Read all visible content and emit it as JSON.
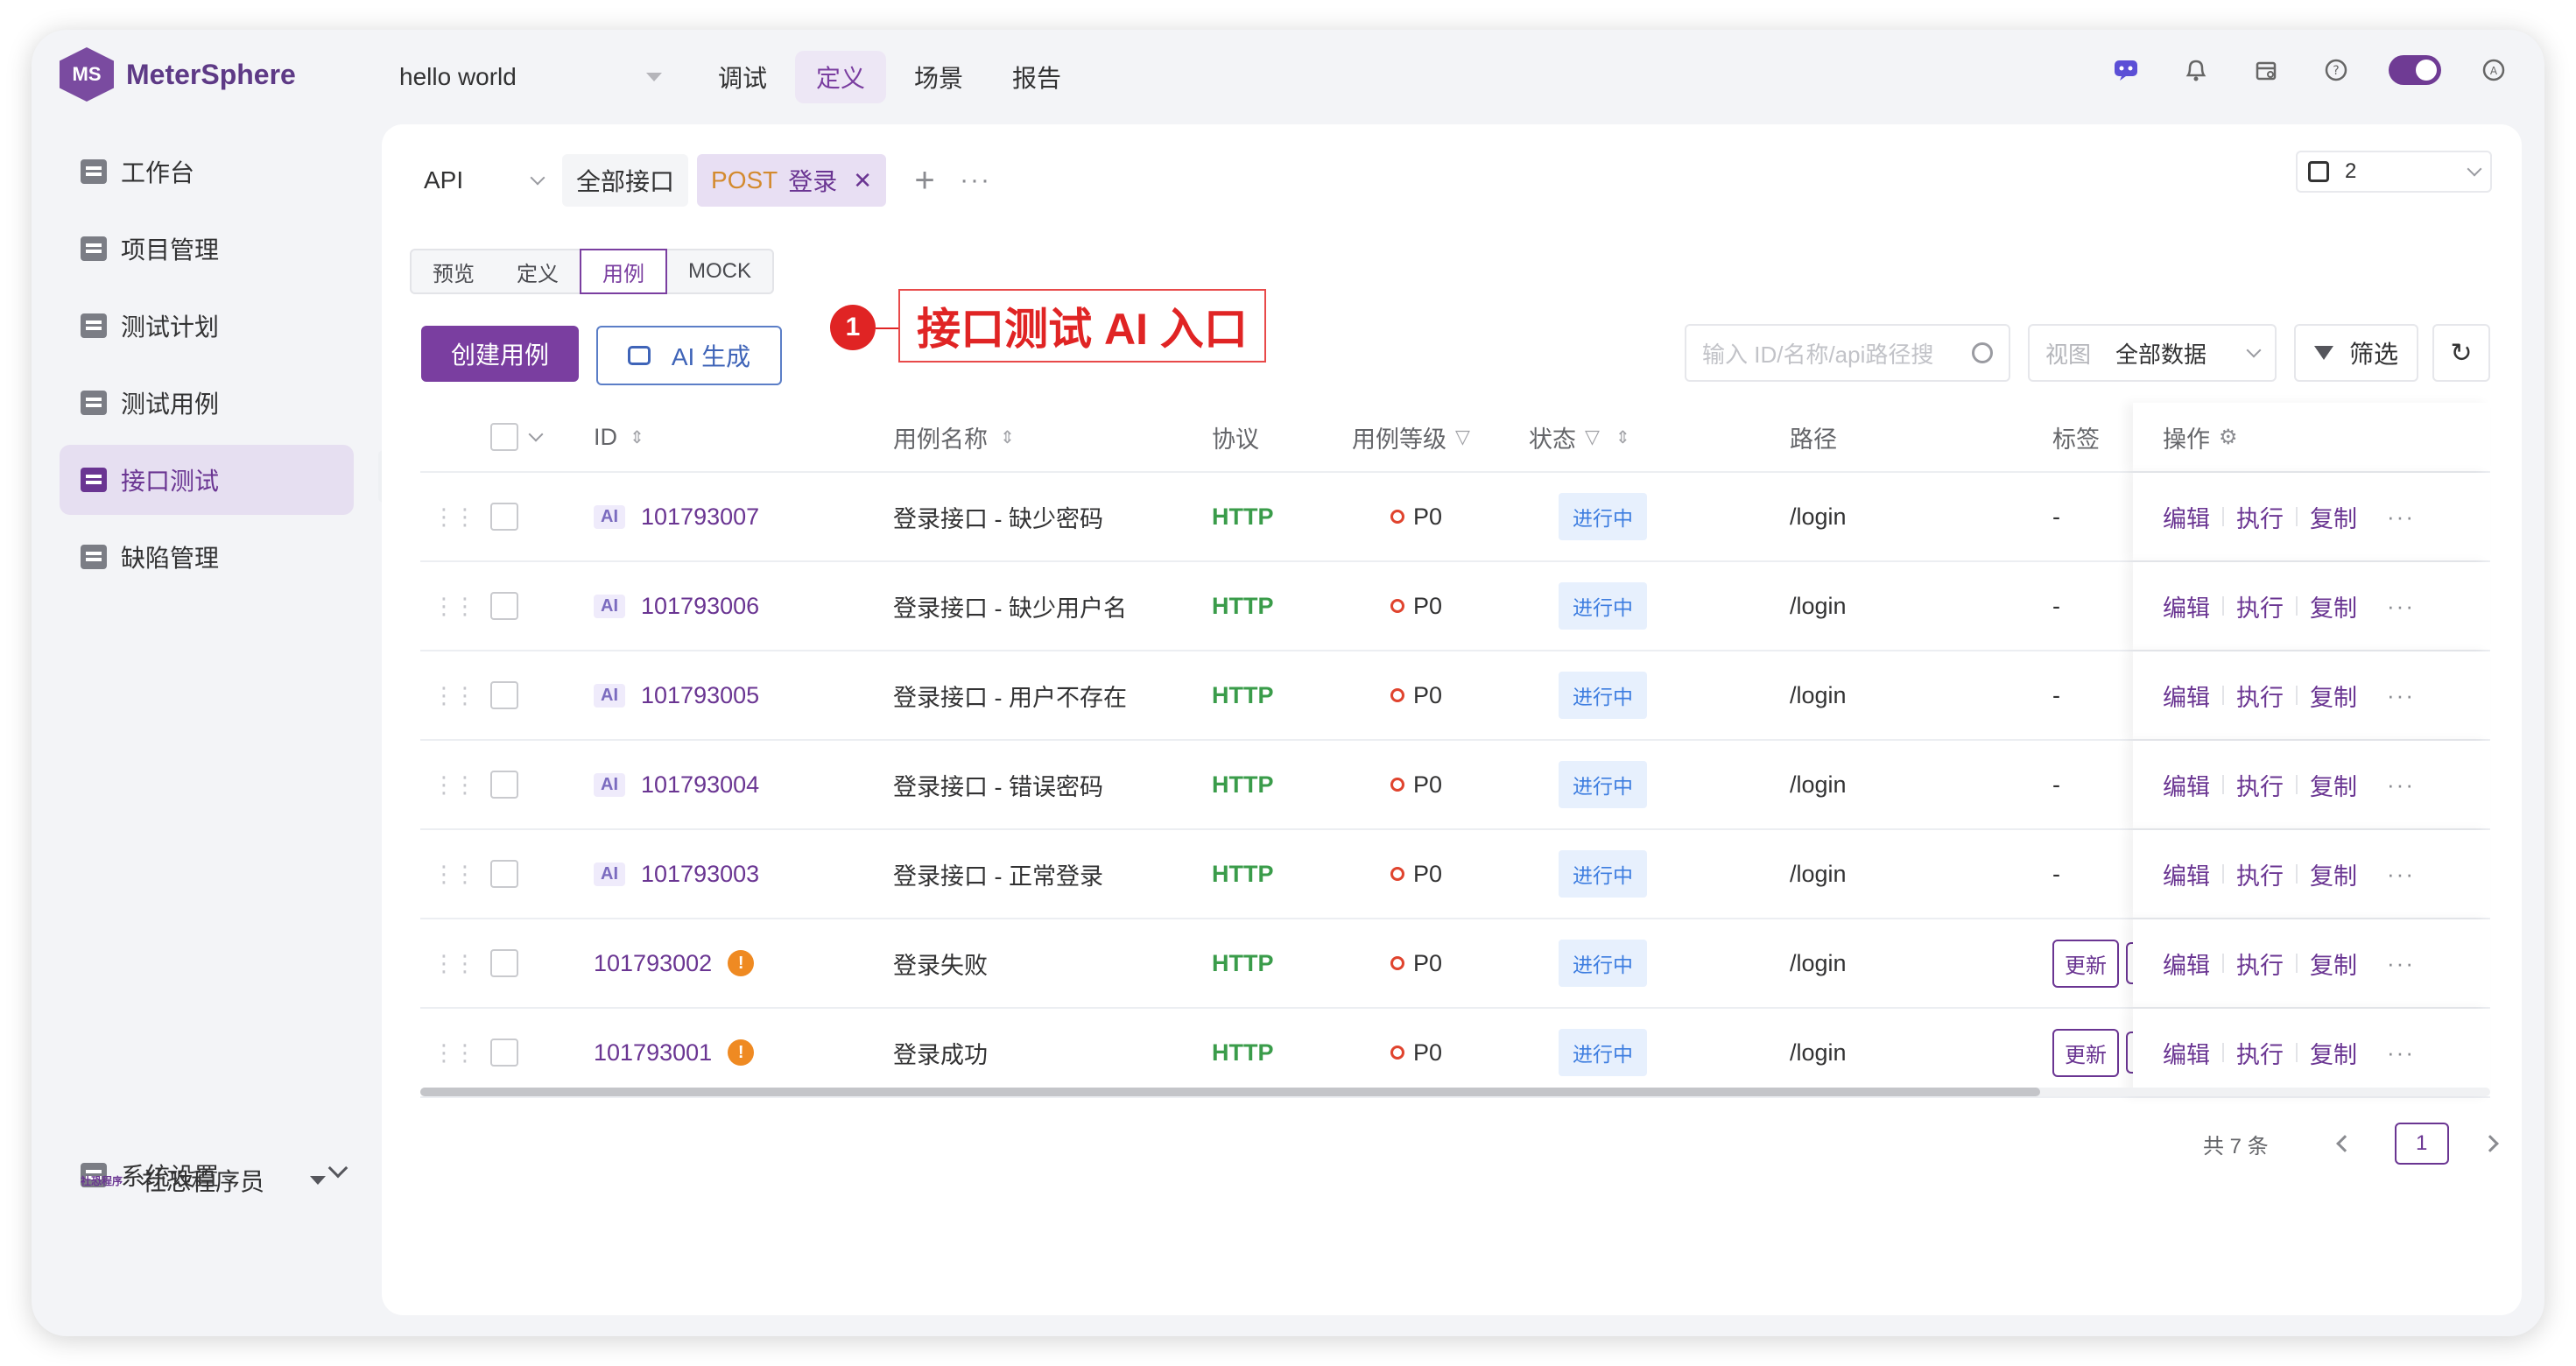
{
  "app": {
    "logo_text": "MeterSphere",
    "project_name": "hello world"
  },
  "top_nav": {
    "items": [
      "调试",
      "定义",
      "场景",
      "报告"
    ],
    "active": "定义"
  },
  "top_icons": [
    "ai-assistant-icon",
    "bell-icon",
    "calendar-icon",
    "help-icon",
    "theme-toggle",
    "avatar-icon"
  ],
  "sidebar": {
    "items": [
      {
        "label": "工作台",
        "icon": "workbench-icon"
      },
      {
        "label": "项目管理",
        "icon": "project-icon"
      },
      {
        "label": "测试计划",
        "icon": "plan-icon"
      },
      {
        "label": "测试用例",
        "icon": "case-icon"
      },
      {
        "label": "接口测试",
        "icon": "api-test-icon"
      },
      {
        "label": "缺陷管理",
        "icon": "bug-icon"
      }
    ],
    "active": "接口测试",
    "settings_label": "系统设置",
    "user_org": "社恐程序",
    "user_name": "社恐程序员"
  },
  "tabbar": {
    "protocol": "API",
    "tabs": [
      {
        "label": "全部接口"
      },
      {
        "method": "POST",
        "label": "登录",
        "closable": true
      }
    ],
    "environment": "2"
  },
  "subtabs": {
    "items": [
      "预览",
      "定义",
      "用例",
      "MOCK"
    ],
    "active": "用例"
  },
  "actions": {
    "create_label": "创建用例",
    "ai_label": "AI 生成"
  },
  "annotation": {
    "number": "1",
    "text": "接口测试 AI 入口"
  },
  "filters": {
    "search_placeholder": "输入 ID/名称/api路径搜",
    "view_label": "视图",
    "view_value": "全部数据",
    "filter_label": "筛选"
  },
  "table": {
    "headers": {
      "id": "ID",
      "name": "用例名称",
      "protocol": "协议",
      "level": "用例等级",
      "status": "状态",
      "path": "路径",
      "tags": "标签",
      "ops": "操作"
    },
    "rows": [
      {
        "ai": "AI",
        "id": "101793007",
        "name": "登录接口 - 缺少密码",
        "protocol": "HTTP",
        "level": "P0",
        "status": "进行中",
        "path": "/login",
        "tag": "-"
      },
      {
        "ai": "AI",
        "id": "101793006",
        "name": "登录接口 - 缺少用户名",
        "protocol": "HTTP",
        "level": "P0",
        "status": "进行中",
        "path": "/login",
        "tag": "-"
      },
      {
        "ai": "AI",
        "id": "101793005",
        "name": "登录接口 - 用户不存在",
        "protocol": "HTTP",
        "level": "P0",
        "status": "进行中",
        "path": "/login",
        "tag": "-"
      },
      {
        "ai": "AI",
        "id": "101793004",
        "name": "登录接口 - 错误密码",
        "protocol": "HTTP",
        "level": "P0",
        "status": "进行中",
        "path": "/login",
        "tag": "-"
      },
      {
        "ai": "AI",
        "id": "101793003",
        "name": "登录接口 - 正常登录",
        "protocol": "HTTP",
        "level": "P0",
        "status": "进行中",
        "path": "/login",
        "tag": "-"
      },
      {
        "ai": "",
        "id": "101793002",
        "warn": "!",
        "name": "登录失败",
        "protocol": "HTTP",
        "level": "P0",
        "status": "进行中",
        "path": "/login",
        "tag_button": "更新"
      },
      {
        "ai": "",
        "id": "101793001",
        "warn": "!",
        "name": "登录成功",
        "protocol": "HTTP",
        "level": "P0",
        "status": "进行中",
        "path": "/login",
        "tag_button": "更新"
      }
    ],
    "row_ops": [
      "编辑",
      "执行",
      "复制"
    ]
  },
  "pager": {
    "total_text": "共 7 条",
    "current_page": "1"
  },
  "colors": {
    "brand": "#7a3ea0",
    "protocol_green": "#3a9c4a",
    "status_blue": "#3d7de0",
    "annotation_red": "#e02424"
  }
}
